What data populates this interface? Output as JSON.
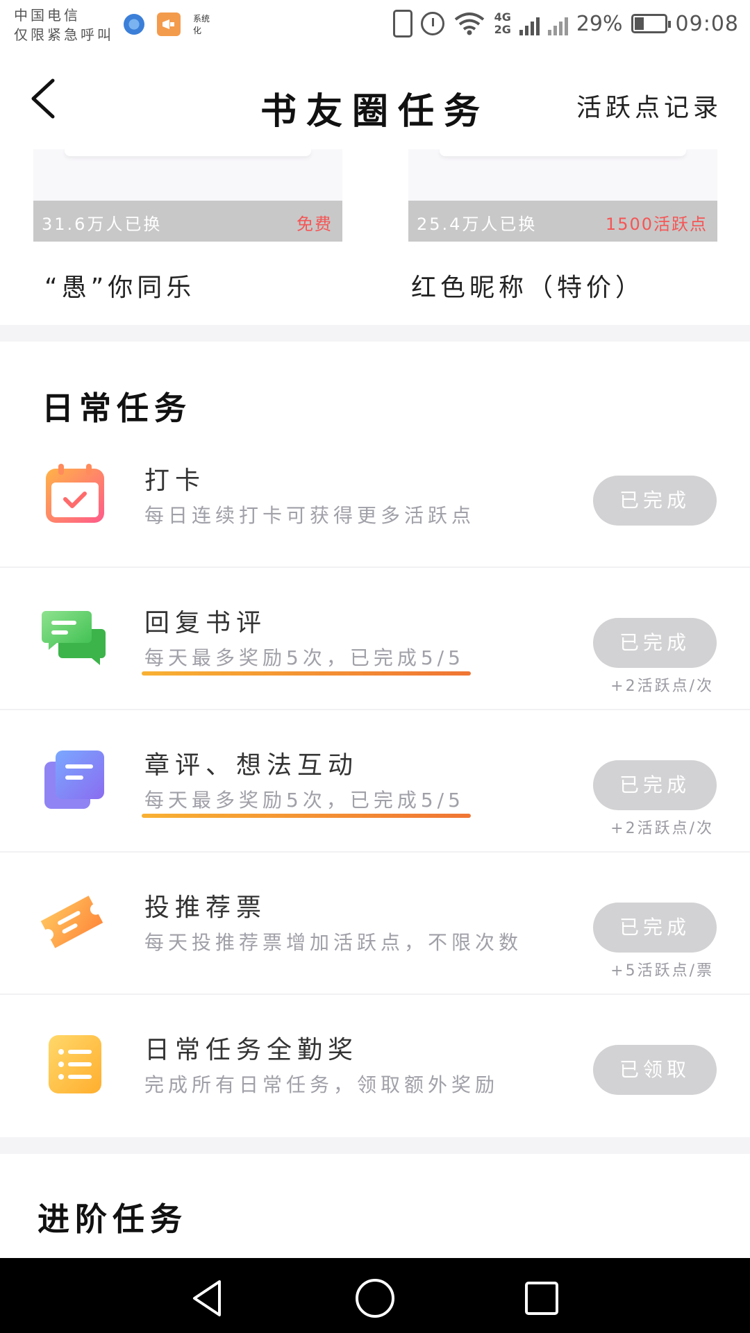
{
  "status_bar": {
    "carrier_line1": "中国电信",
    "carrier_line2": "仅限紧急呼叫",
    "network_4g": "4G",
    "network_2g": "2G",
    "battery_percent": "29%",
    "time": "09:08",
    "app_icon_label": "系统化"
  },
  "header": {
    "title": "书友圈任务",
    "record_link": "活跃点记录"
  },
  "shop": {
    "cards": [
      {
        "count": "31.6万人已换",
        "price": "免费",
        "name": "“愚”你同乐"
      },
      {
        "count": "25.4万人已换",
        "price": "1500活跃点",
        "name": "红色昵称（特价）"
      }
    ]
  },
  "daily": {
    "title": "日常任务",
    "tasks": [
      {
        "name": "打卡",
        "desc": "每日连续打卡可获得更多活跃点",
        "button": "已完成",
        "reward": ""
      },
      {
        "name": "回复书评",
        "desc": "每天最多奖励5次，已完成5/5",
        "button": "已完成",
        "reward": "+2活跃点/次"
      },
      {
        "name": "章评、想法互动",
        "desc": "每天最多奖励5次，已完成5/5",
        "button": "已完成",
        "reward": "+2活跃点/次"
      },
      {
        "name": "投推荐票",
        "desc": "每天投推荐票增加活跃点，不限次数",
        "button": "已完成",
        "reward": "+5活跃点/票"
      },
      {
        "name": "日常任务全勤奖",
        "desc": "完成所有日常任务，领取额外奖励",
        "button": "已领取",
        "reward": ""
      }
    ]
  },
  "advanced": {
    "title": "进阶任务"
  },
  "colors": {
    "button_done": "#d2d2d4",
    "price_red": "#f55555",
    "progress_start": "#f8b133",
    "progress_end": "#f07534"
  }
}
